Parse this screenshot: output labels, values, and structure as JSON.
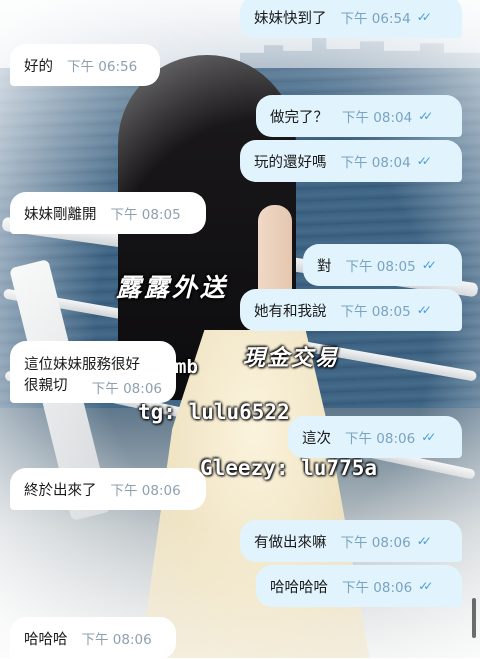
{
  "watermark": {
    "title": "露露外送",
    "cash": "現金交易",
    "tg": "tg: lulu6522",
    "gleezy": "Gleezy: lu775a",
    "mb": "mb"
  },
  "messages": [
    {
      "dir": "out",
      "text": "妹妹快到了",
      "time": "下午 06:54"
    },
    {
      "dir": "in",
      "text": "好的",
      "time": "下午 06:56"
    },
    {
      "dir": "out",
      "text": "做完了？",
      "time": "下午 08:04"
    },
    {
      "dir": "out",
      "text": "玩的還好嗎",
      "time": "下午 08:04"
    },
    {
      "dir": "in",
      "text": "妹妹剛離開",
      "time": "下午 08:05"
    },
    {
      "dir": "out",
      "text": "對",
      "time": "下午 08:05"
    },
    {
      "dir": "out",
      "text": "她有和我說",
      "time": "下午 08:05"
    },
    {
      "dir": "in",
      "text": "這位妹妹服務很好很親切",
      "time": "下午 08:06"
    },
    {
      "dir": "out",
      "text": "這次",
      "time": "下午 08:06"
    },
    {
      "dir": "in",
      "text": "終於出來了",
      "time": "下午 08:06"
    },
    {
      "dir": "out",
      "text": "有做出來嘛",
      "time": "下午 08:06"
    },
    {
      "dir": "out",
      "text": "哈哈哈哈",
      "time": "下午 08:06"
    },
    {
      "dir": "in",
      "text": "哈哈哈",
      "time": "下午 08:06"
    }
  ],
  "read_receipt": "✓✓",
  "colors": {
    "incoming": "#ffffff",
    "outgoing": "#e1f3fd",
    "check": "#4a9bd8"
  }
}
